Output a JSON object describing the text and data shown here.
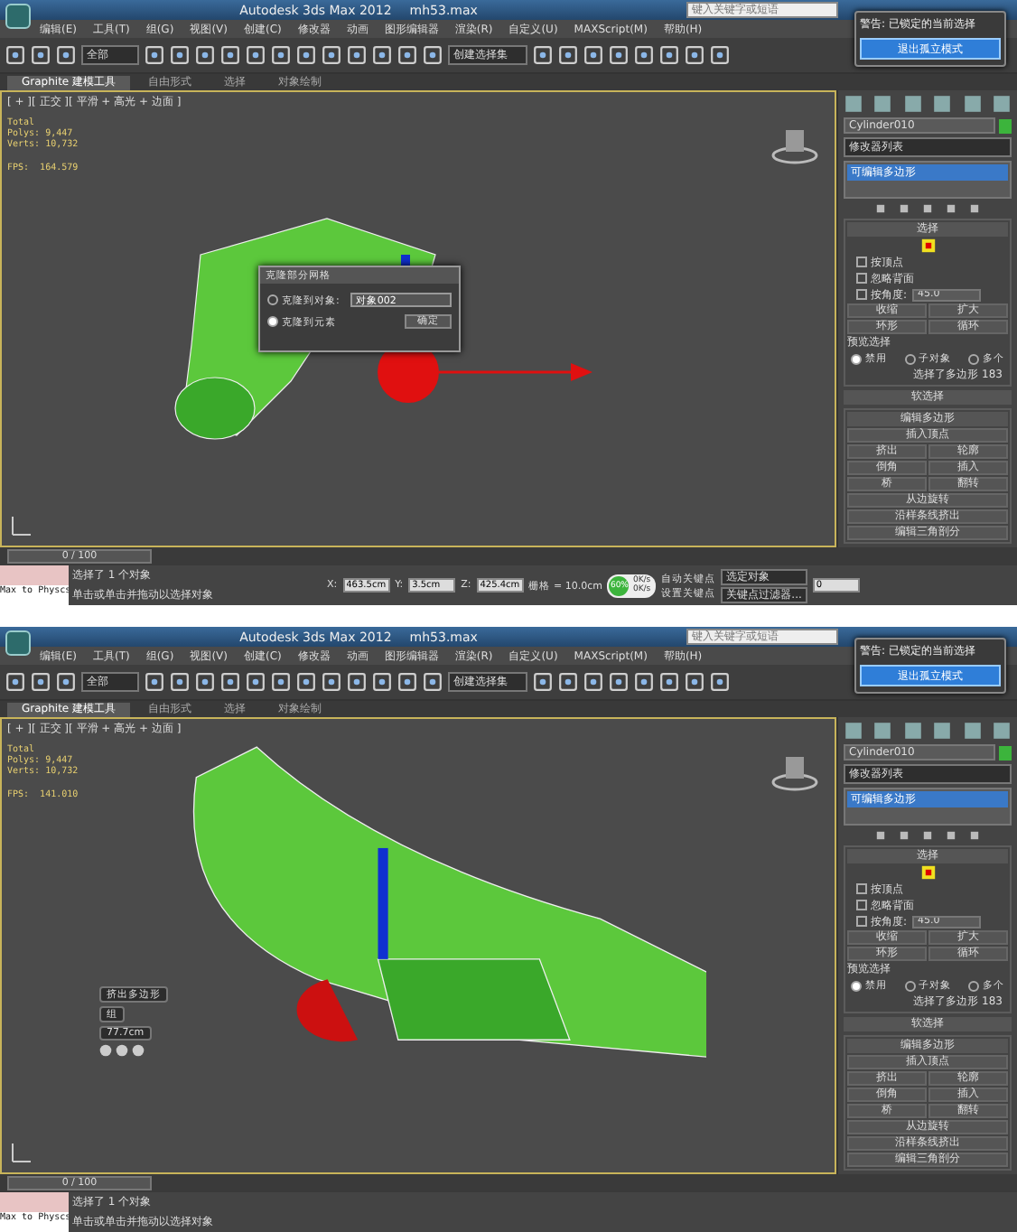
{
  "screens": [
    {
      "title": "Autodesk 3ds Max  2012",
      "file": "mh53.max",
      "search": {
        "placeholder": "键入关键字或短语"
      },
      "menus": [
        "编辑(E)",
        "工具(T)",
        "组(G)",
        "视图(V)",
        "创建(C)",
        "修改器",
        "动画",
        "图形编辑器",
        "渲染(R)",
        "自定义(U)",
        "MAXScript(M)",
        "帮助(H)"
      ],
      "selection_filter": "全部",
      "selection_set": "创建选择集",
      "ribbon_tabs": [
        {
          "label": "Graphite 建模工具",
          "selected": true
        },
        {
          "label": "自由形式",
          "selected": false
        },
        {
          "label": "选择",
          "selected": false
        },
        {
          "label": "对象绘制",
          "selected": false
        }
      ],
      "warning": {
        "title": "警告: 已锁定的当前选择",
        "button": "退出孤立模式"
      },
      "viewport": {
        "label": "[ + ][ 正交 ][ 平滑 + 高光 + 边面 ]",
        "stats": [
          "Total",
          "Polys: 9,447",
          "Verts: 10,732"
        ],
        "fps": "FPS:  164.579",
        "kind": "clone"
      },
      "dialog": {
        "title": "克隆部分网格",
        "options": [
          {
            "label": "克隆到对象:",
            "selected": false
          },
          {
            "label": "克隆到元素",
            "selected": true
          }
        ],
        "value": "对象002",
        "button": "确定"
      },
      "panel": {
        "object_name": "Cylinder010",
        "modifier_list": "修改器列表",
        "stack": [
          {
            "label": "可编辑多边形",
            "selected": true
          }
        ],
        "selection": {
          "title": "选择",
          "checks": [
            {
              "label": "按顶点",
              "checked": false
            },
            {
              "label": "忽略背面",
              "checked": false
            },
            {
              "label": "按角度:",
              "checked": false
            }
          ],
          "angle": "45.0",
          "buttons": [
            "收缩",
            "扩大",
            "环形",
            "循环"
          ],
          "preview_title": "预览选择",
          "preview": [
            {
              "label": "禁用",
              "selected": true
            },
            {
              "label": "子对象",
              "selected": false
            },
            {
              "label": "多个",
              "selected": false
            }
          ],
          "info": "选择了多边形 183"
        },
        "soft_selection": "软选择",
        "edit_title": "编辑多边形",
        "edit_buttons": [
          {
            "label": "插入顶点",
            "kind": "wide"
          },
          {
            "label": "挤出",
            "kind": "half"
          },
          {
            "label": "轮廓",
            "kind": "half"
          },
          {
            "label": "倒角",
            "kind": "half"
          },
          {
            "label": "插入",
            "kind": "half"
          },
          {
            "label": "桥",
            "kind": "half"
          },
          {
            "label": "翻转",
            "kind": "half"
          },
          {
            "label": "从边旋转",
            "kind": "wide"
          },
          {
            "label": "沿样条线挤出",
            "kind": "wide"
          },
          {
            "label": "编辑三角剖分",
            "kind": "wide"
          }
        ]
      },
      "timeline": {
        "label": "0 / 100"
      },
      "status": {
        "script": "Max to Physcs",
        "prompt1": "选择了 1 个对象",
        "prompt2": "单击或单击并拖动以选择对象",
        "coords": [
          {
            "label": "X:",
            "value": "463.5cm"
          },
          {
            "label": "Y:",
            "value": "3.5cm"
          },
          {
            "label": "Z:",
            "value": "425.4cm"
          }
        ],
        "grid": "栅格 = 10.0cm",
        "meter": {
          "percent": "60%",
          "up": "0K/s",
          "down": "0K/s"
        },
        "autokey": "自动关键点",
        "keymode": "选定对象",
        "setkey": "设置关键点",
        "filters": "关键点过滤器...",
        "frame": "0"
      }
    },
    {
      "title": "Autodesk 3ds Max  2012",
      "file": "mh53.max",
      "search": {
        "placeholder": "键入关键字或短语"
      },
      "menus": [
        "编辑(E)",
        "工具(T)",
        "组(G)",
        "视图(V)",
        "创建(C)",
        "修改器",
        "动画",
        "图形编辑器",
        "渲染(R)",
        "自定义(U)",
        "MAXScript(M)",
        "帮助(H)"
      ],
      "selection_filter": "全部",
      "selection_set": "创建选择集",
      "ribbon_tabs": [
        {
          "label": "Graphite 建模工具",
          "selected": true
        },
        {
          "label": "自由形式",
          "selected": false
        },
        {
          "label": "选择",
          "selected": false
        },
        {
          "label": "对象绘制",
          "selected": false
        }
      ],
      "warning": {
        "title": "警告: 已锁定的当前选择",
        "button": "退出孤立模式"
      },
      "viewport": {
        "label": "[ + ][ 正交 ][ 平滑 + 高光 + 边面 ]",
        "stats": [
          "Total",
          "Polys: 9,447",
          "Verts: 10,732"
        ],
        "fps": "FPS:  141.010",
        "kind": "extrude"
      },
      "caddy": {
        "title": "挤出多边形",
        "mode": "组",
        "value": "77.7cm"
      },
      "panel": {
        "object_name": "Cylinder010",
        "modifier_list": "修改器列表",
        "stack": [
          {
            "label": "可编辑多边形",
            "selected": true
          }
        ],
        "selection": {
          "title": "选择",
          "checks": [
            {
              "label": "按顶点",
              "checked": false
            },
            {
              "label": "忽略背面",
              "checked": false
            },
            {
              "label": "按角度:",
              "checked": false
            }
          ],
          "angle": "45.0",
          "buttons": [
            "收缩",
            "扩大",
            "环形",
            "循环"
          ],
          "preview_title": "预览选择",
          "preview": [
            {
              "label": "禁用",
              "selected": true
            },
            {
              "label": "子对象",
              "selected": false
            },
            {
              "label": "多个",
              "selected": false
            }
          ],
          "info": "选择了多边形 183"
        },
        "soft_selection": "软选择",
        "edit_title": "编辑多边形",
        "edit_buttons": [
          {
            "label": "插入顶点",
            "kind": "wide"
          },
          {
            "label": "挤出",
            "kind": "half"
          },
          {
            "label": "轮廓",
            "kind": "half"
          },
          {
            "label": "倒角",
            "kind": "half"
          },
          {
            "label": "插入",
            "kind": "half"
          },
          {
            "label": "桥",
            "kind": "half"
          },
          {
            "label": "翻转",
            "kind": "half"
          },
          {
            "label": "从边旋转",
            "kind": "wide"
          },
          {
            "label": "沿样条线挤出",
            "kind": "wide"
          },
          {
            "label": "编辑三角剖分",
            "kind": "wide"
          }
        ]
      },
      "timeline": {
        "label": "0 / 100"
      },
      "status": {
        "script": "Max to Physcs",
        "prompt1": "选择了 1 个对象",
        "prompt2": "单击或单击并拖动以选择对象"
      }
    }
  ]
}
